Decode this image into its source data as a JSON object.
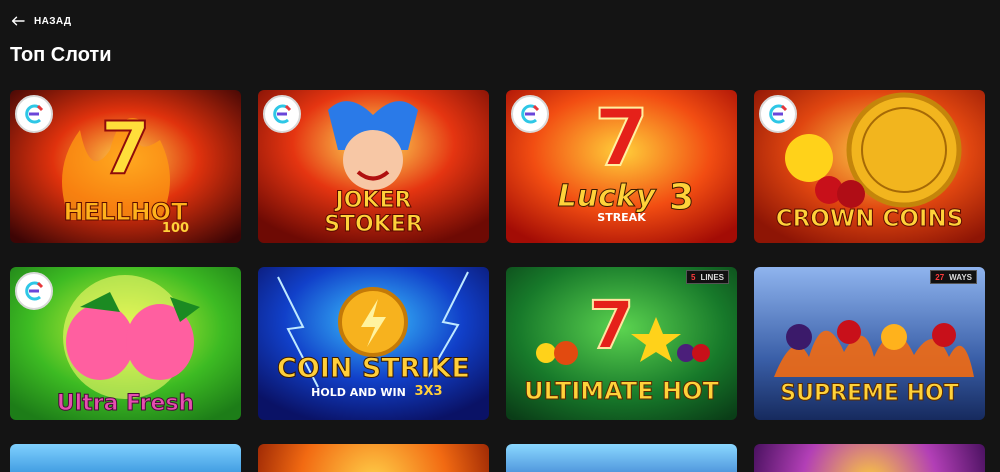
{
  "nav": {
    "back_label": "НАЗАД",
    "back_icon": "arrow-left-icon"
  },
  "page": {
    "title": "Топ Слоти"
  },
  "provider_badge": {
    "icon": "provider-logo-icon",
    "colors": [
      "#2ec7e6",
      "#6a45d9",
      "#e8373a"
    ]
  },
  "games": [
    {
      "title": "HELLHOT",
      "subtitle": "100",
      "badge": true,
      "bg": [
        "#f6a41b",
        "#c81a0c",
        "#4a0707"
      ]
    },
    {
      "title": "JOKER",
      "subtitle": "STOKER",
      "badge": true,
      "bg": [
        "#ffd43a",
        "#e53511",
        "#7a0b05"
      ]
    },
    {
      "title": "Lucky",
      "subtitle": "STREAK",
      "extra": "3",
      "badge": true,
      "bg": [
        "#ffb21c",
        "#ef3a10",
        "#a00e05"
      ]
    },
    {
      "title": "CROWN COINS",
      "badge": true,
      "bg": [
        "#ffcf3a",
        "#e04610",
        "#8e1505"
      ]
    },
    {
      "title": "Ultra Fresh",
      "badge": true,
      "bg": [
        "#9fe62b",
        "#3dbb23",
        "#1d7d18"
      ]
    },
    {
      "title": "COIN STRIKE",
      "subtitle": "HOLD AND WIN",
      "extra": "3x3",
      "badge": false,
      "bg": [
        "#2aa7ff",
        "#1140c9",
        "#0a1266"
      ]
    },
    {
      "title": "ULTIMATE HOT",
      "lines_num": "5",
      "lines_word": "LINES",
      "badge": false,
      "bg": [
        "#46b93d",
        "#17792a",
        "#0a3d17"
      ]
    },
    {
      "title": "SUPREME HOT",
      "lines_num": "27",
      "lines_word": "WAYS",
      "badge": false,
      "bg": [
        "#7fa6e6",
        "#3a5fa8",
        "#162a5e"
      ]
    }
  ],
  "partial_row_colors": [
    "#7fd0ff",
    "#f26a12",
    "#8ad8ff",
    "#b23fb6"
  ]
}
